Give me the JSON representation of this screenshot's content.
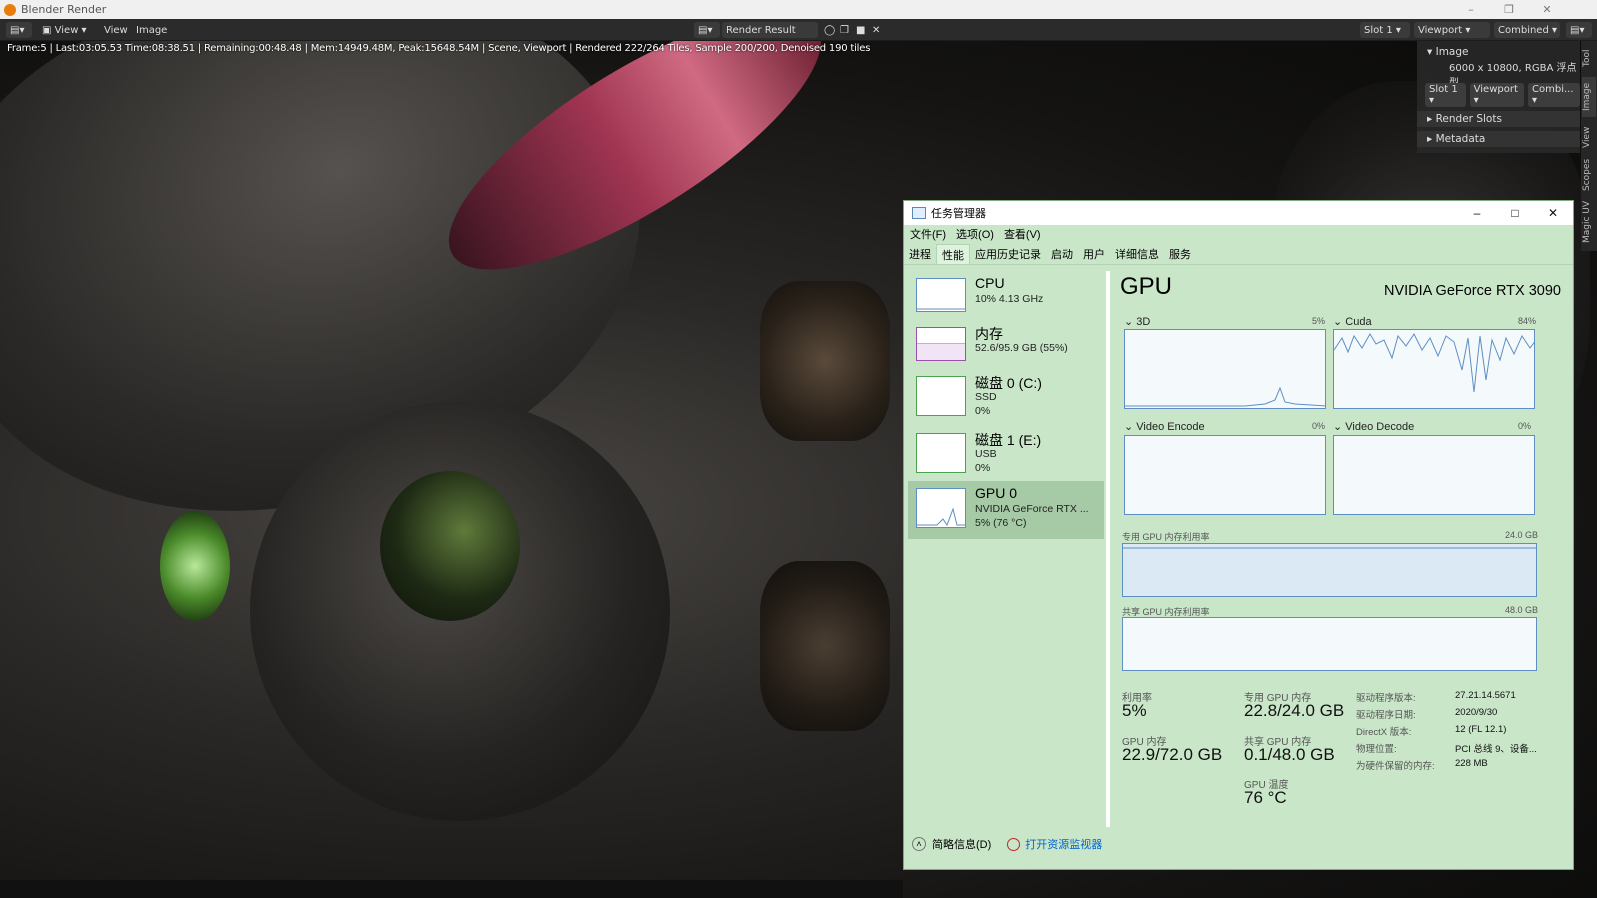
{
  "window": {
    "title": "Blender Render"
  },
  "header": {
    "view_menu": "View",
    "view2": "View",
    "image_menu": "Image",
    "render_result": "Render Result",
    "slot": "Slot 1",
    "viewport": "Viewport",
    "combined": "Combined"
  },
  "stats_line": "Frame:5 | Last:03:05.53 Time:08:38.51 | Remaining:00:48.48 | Mem:14949.48M, Peak:15648.54M | Scene, Viewport | Rendered 222/264 Tiles, Sample 200/200, Denoised 190 tiles",
  "npanel": {
    "section": "Image",
    "resolution": "6000 x 10800,  RGBA 浮点型",
    "slot": "Slot 1",
    "viewport": "Viewport",
    "combi": "Combi...",
    "render_slots": "Render Slots",
    "metadata": "Metadata"
  },
  "sidetabs": [
    "Tool",
    "Image",
    "View",
    "Scopes",
    "Magic UV"
  ],
  "taskmgr": {
    "title": "任务管理器",
    "menu": [
      "文件(F)",
      "选项(O)",
      "查看(V)"
    ],
    "tabs": [
      "进程",
      "性能",
      "应用历史记录",
      "启动",
      "用户",
      "详细信息",
      "服务"
    ],
    "active_tab": 1,
    "perf_items": [
      {
        "name": "CPU",
        "line2": "10%  4.13 GHz",
        "line3": ""
      },
      {
        "name": "内存",
        "line2": "52.6/95.9 GB (55%)",
        "line3": ""
      },
      {
        "name": "磁盘 0 (C:)",
        "line2": "SSD",
        "line3": "0%"
      },
      {
        "name": "磁盘 1 (E:)",
        "line2": "USB",
        "line3": "0%"
      },
      {
        "name": "GPU 0",
        "line2": "NVIDIA GeForce RTX ...",
        "line3": "5% (76 °C)"
      }
    ],
    "gpu": {
      "title": "GPU",
      "model": "NVIDIA GeForce RTX 3090",
      "engines": [
        {
          "label": "3D",
          "pct": "5%"
        },
        {
          "label": "Cuda",
          "pct": "84%"
        },
        {
          "label": "Video Encode",
          "pct": "0%"
        },
        {
          "label": "Video Decode",
          "pct": "0%"
        }
      ],
      "dedicated_label": "专用 GPU 内存利用率",
      "dedicated_max": "24.0 GB",
      "shared_label": "共享 GPU 内存利用率",
      "shared_max": "48.0 GB",
      "util_label": "利用率",
      "util_value": "5%",
      "ded_mem_label": "专用 GPU 内存",
      "ded_mem_value": "22.8/24.0 GB",
      "gpu_mem_label": "GPU 内存",
      "gpu_mem_value": "22.9/72.0 GB",
      "shared_mem_label": "共享 GPU 内存",
      "shared_mem_value": "0.1/48.0 GB",
      "temp_label": "GPU 温度",
      "temp_value": "76 °C",
      "details": [
        {
          "label": "驱动程序版本:",
          "value": "27.21.14.5671"
        },
        {
          "label": "驱动程序日期:",
          "value": "2020/9/30"
        },
        {
          "label": "DirectX 版本:",
          "value": "12 (FL 12.1)"
        },
        {
          "label": "物理位置:",
          "value": "PCI 总线 9、设备..."
        },
        {
          "label": "为硬件保留的内存:",
          "value": "228 MB"
        }
      ]
    },
    "footer": {
      "summary": "简略信息(D)",
      "resmon": "打开资源监视器"
    }
  },
  "colors": {
    "accent_graph": "#5e8ec2",
    "tm_bg": "#c9e6c9",
    "blender_bg": "#2b2b2b"
  }
}
